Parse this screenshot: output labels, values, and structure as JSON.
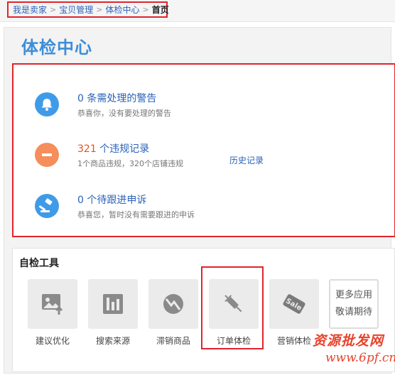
{
  "breadcrumb": {
    "items": [
      "我是卖家",
      "宝贝管理",
      "体检中心"
    ],
    "current": "首页",
    "separator": ">"
  },
  "page_title": "体检中心",
  "summary": {
    "warnings": {
      "count": "0",
      "text": "条需处理的警告",
      "sub": "恭喜你，没有要处理的警告",
      "icon": "bell-icon"
    },
    "violations": {
      "count": "321",
      "text": "个违规记录",
      "sub": "1个商品违规，320个店铺违规",
      "link": "历史记录",
      "icon": "minus-circle-icon"
    },
    "appeals": {
      "count": "0",
      "text": "个待跟进申诉",
      "sub": "恭喜您，暂时没有需要跟进的申诉",
      "icon": "gavel-icon"
    }
  },
  "tools": {
    "title": "自检工具",
    "items": [
      {
        "label": "建议优化",
        "icon": "image-upload-icon"
      },
      {
        "label": "搜索来源",
        "icon": "bar-chart-icon"
      },
      {
        "label": "滞销商品",
        "icon": "trend-down-icon"
      },
      {
        "label": "订单体检",
        "icon": "syringe-icon"
      },
      {
        "label": "营销体检",
        "icon": "sale-tag-icon"
      }
    ],
    "more": {
      "line1": "更多应用",
      "line2": "敬请期待"
    }
  },
  "watermark": {
    "line1": "资源批发网",
    "line2": "www.6pf.cn"
  },
  "colors": {
    "link": "#2a62b8",
    "accent": "#3d8ed8",
    "danger": "#e0242b",
    "count_red": "#e8501f"
  }
}
